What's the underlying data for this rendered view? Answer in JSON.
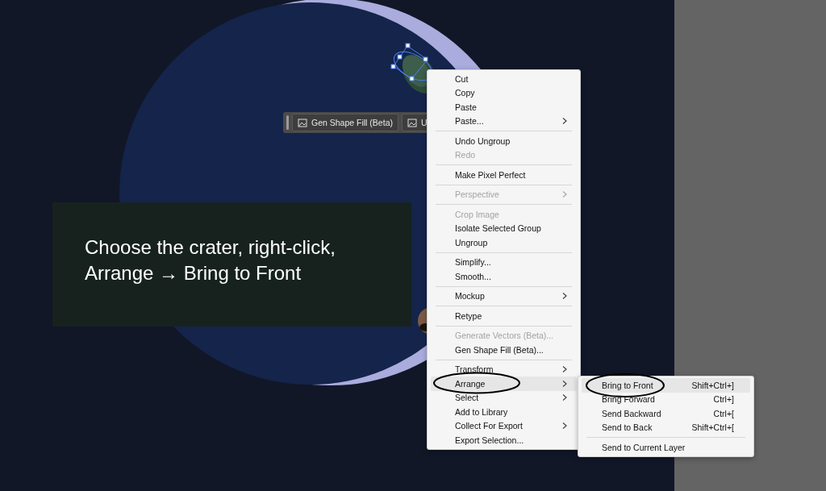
{
  "toolbar": {
    "buttons": [
      {
        "label": "Gen Shape Fill (Beta)"
      },
      {
        "label": "U"
      }
    ]
  },
  "caption": {
    "text": "Choose the crater, right-click, Arrange → Bring to Front"
  },
  "context_menu": {
    "groups": [
      [
        {
          "label": "Cut",
          "disabled": false,
          "submenu": false,
          "selected": false
        },
        {
          "label": "Copy",
          "disabled": false,
          "submenu": false,
          "selected": false
        },
        {
          "label": "Paste",
          "disabled": false,
          "submenu": false,
          "selected": false
        },
        {
          "label": "Paste...",
          "disabled": false,
          "submenu": true,
          "selected": false
        }
      ],
      [
        {
          "label": "Undo Ungroup",
          "disabled": false,
          "submenu": false,
          "selected": false
        },
        {
          "label": "Redo",
          "disabled": true,
          "submenu": false,
          "selected": false
        }
      ],
      [
        {
          "label": "Make Pixel Perfect",
          "disabled": false,
          "submenu": false,
          "selected": false
        }
      ],
      [
        {
          "label": "Perspective",
          "disabled": true,
          "submenu": true,
          "selected": false
        }
      ],
      [
        {
          "label": "Crop Image",
          "disabled": true,
          "submenu": false,
          "selected": false
        },
        {
          "label": "Isolate Selected Group",
          "disabled": false,
          "submenu": false,
          "selected": false
        },
        {
          "label": "Ungroup",
          "disabled": false,
          "submenu": false,
          "selected": false
        }
      ],
      [
        {
          "label": "Simplify...",
          "disabled": false,
          "submenu": false,
          "selected": false
        },
        {
          "label": "Smooth...",
          "disabled": false,
          "submenu": false,
          "selected": false
        }
      ],
      [
        {
          "label": "Mockup",
          "disabled": false,
          "submenu": true,
          "selected": false
        }
      ],
      [
        {
          "label": "Retype",
          "disabled": false,
          "submenu": false,
          "selected": false
        }
      ],
      [
        {
          "label": "Generate Vectors (Beta)...",
          "disabled": true,
          "submenu": false,
          "selected": false
        },
        {
          "label": "Gen Shape Fill (Beta)...",
          "disabled": false,
          "submenu": false,
          "selected": false
        }
      ],
      [
        {
          "label": "Transform",
          "disabled": false,
          "submenu": true,
          "selected": false
        },
        {
          "label": "Arrange",
          "disabled": false,
          "submenu": true,
          "selected": true
        },
        {
          "label": "Select",
          "disabled": false,
          "submenu": true,
          "selected": false
        },
        {
          "label": "Add to Library",
          "disabled": false,
          "submenu": false,
          "selected": false
        },
        {
          "label": "Collect For Export",
          "disabled": false,
          "submenu": true,
          "selected": false
        },
        {
          "label": "Export Selection...",
          "disabled": false,
          "submenu": false,
          "selected": false
        }
      ]
    ]
  },
  "submenu": {
    "groups": [
      [
        {
          "label": "Bring to Front",
          "shortcut": "Shift+Ctrl+]",
          "selected": true
        },
        {
          "label": "Bring Forward",
          "shortcut": "Ctrl+]",
          "selected": false
        },
        {
          "label": "Send Backward",
          "shortcut": "Ctrl+[",
          "selected": false
        },
        {
          "label": "Send to Back",
          "shortcut": "Shift+Ctrl+[",
          "selected": false
        }
      ],
      [
        {
          "label": "Send to Current Layer",
          "selected": false
        }
      ]
    ]
  }
}
